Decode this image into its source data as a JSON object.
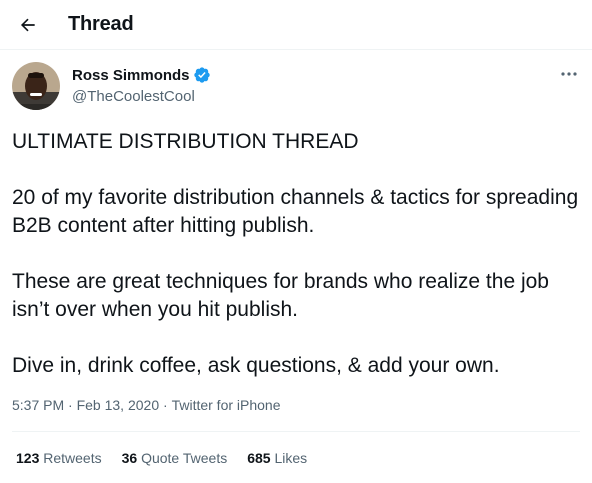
{
  "header": {
    "back_icon": "arrow-left-icon",
    "title": "Thread"
  },
  "author": {
    "avatar_icon": "avatar-photo",
    "name": "Ross Simmonds",
    "verified_icon": "verified-badge-icon",
    "handle": "@TheCoolestCool"
  },
  "more_icon": "more-horizontal-icon",
  "tweet": {
    "lines": [
      "ULTIMATE DISTRIBUTION THREAD",
      "20 of my favorite distribution channels & tactics for spreading B2B content after hitting publish.",
      "These are great techniques for brands who realize the job isn’t over when you hit publish.",
      "Dive in, drink coffee, ask questions, & add your own."
    ]
  },
  "meta": {
    "time": "5:37 PM",
    "sep1": " · ",
    "date": "Feb 13, 2020",
    "sep2": " · ",
    "source": "Twitter for iPhone"
  },
  "stats": {
    "retweets_count": "123",
    "retweets_label": "Retweets",
    "quotes_count": "36",
    "quotes_label": "Quote Tweets",
    "likes_count": "685",
    "likes_label": "Likes"
  },
  "colors": {
    "text": "#0f1419",
    "secondary": "#536471",
    "verified": "#1d9bf0",
    "border": "#eff3f4"
  }
}
